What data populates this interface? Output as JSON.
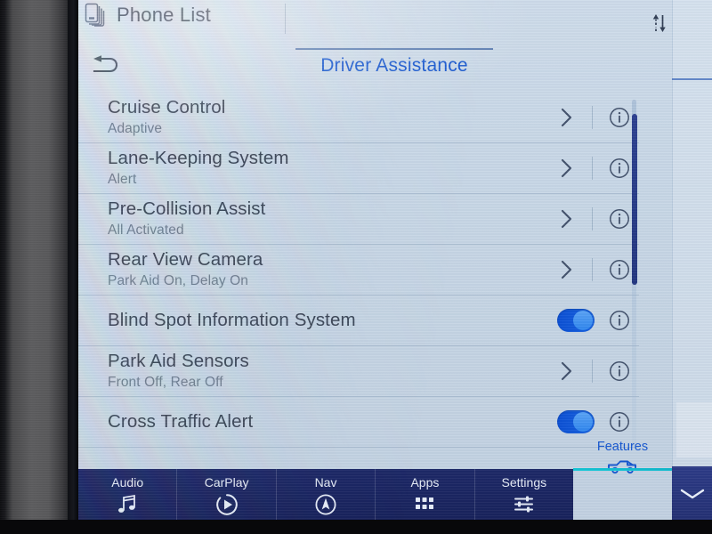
{
  "statusbar": {
    "app_label": "Phone List",
    "app_icon": "phone-list-icon",
    "data_icon": "data-transfer-icon",
    "wifi_icon": "wifi-info-icon"
  },
  "header": {
    "back_icon": "back-arrow-icon",
    "title": "Driver Assistance",
    "title_color": "#1455cf"
  },
  "list": {
    "rows": [
      {
        "title": "Cruise Control",
        "subtitle": "Adaptive",
        "control": "chevron",
        "info": "i"
      },
      {
        "title": "Lane-Keeping System",
        "subtitle": "Alert",
        "control": "chevron",
        "info": "i"
      },
      {
        "title": "Pre-Collision Assist",
        "subtitle": "All Activated",
        "control": "chevron",
        "info": "i"
      },
      {
        "title": "Rear View Camera",
        "subtitle": "Park Aid On, Delay On",
        "control": "chevron",
        "info": "i"
      },
      {
        "title": "Blind Spot Information System",
        "subtitle": "",
        "control": "toggle",
        "toggle_state": "on",
        "info": "i"
      },
      {
        "title": "Park Aid Sensors",
        "subtitle": "Front Off, Rear Off",
        "control": "chevron",
        "info": "i"
      },
      {
        "title": "Cross Traffic Alert",
        "subtitle": "",
        "control": "toggle",
        "toggle_state": "on",
        "info": "i"
      }
    ]
  },
  "features_tab": {
    "label": "Features",
    "icon": "vehicle-icon",
    "active": true,
    "accent_color": "#0fb9cc"
  },
  "right_panel": {
    "expand_icon": "chevron-down-icon"
  },
  "navbar": {
    "items": [
      {
        "label": "Audio",
        "icon": "music-note-icon"
      },
      {
        "label": "CarPlay",
        "icon": "play-circle-icon"
      },
      {
        "label": "Nav",
        "icon": "compass-icon"
      },
      {
        "label": "Apps",
        "icon": "grid-apps-icon"
      },
      {
        "label": "Settings",
        "icon": "sliders-icon"
      }
    ],
    "background_color": "#1c2766"
  },
  "toggle_colors": {
    "track_on": "#0b4fd4",
    "knob": "#5aa3f5"
  }
}
